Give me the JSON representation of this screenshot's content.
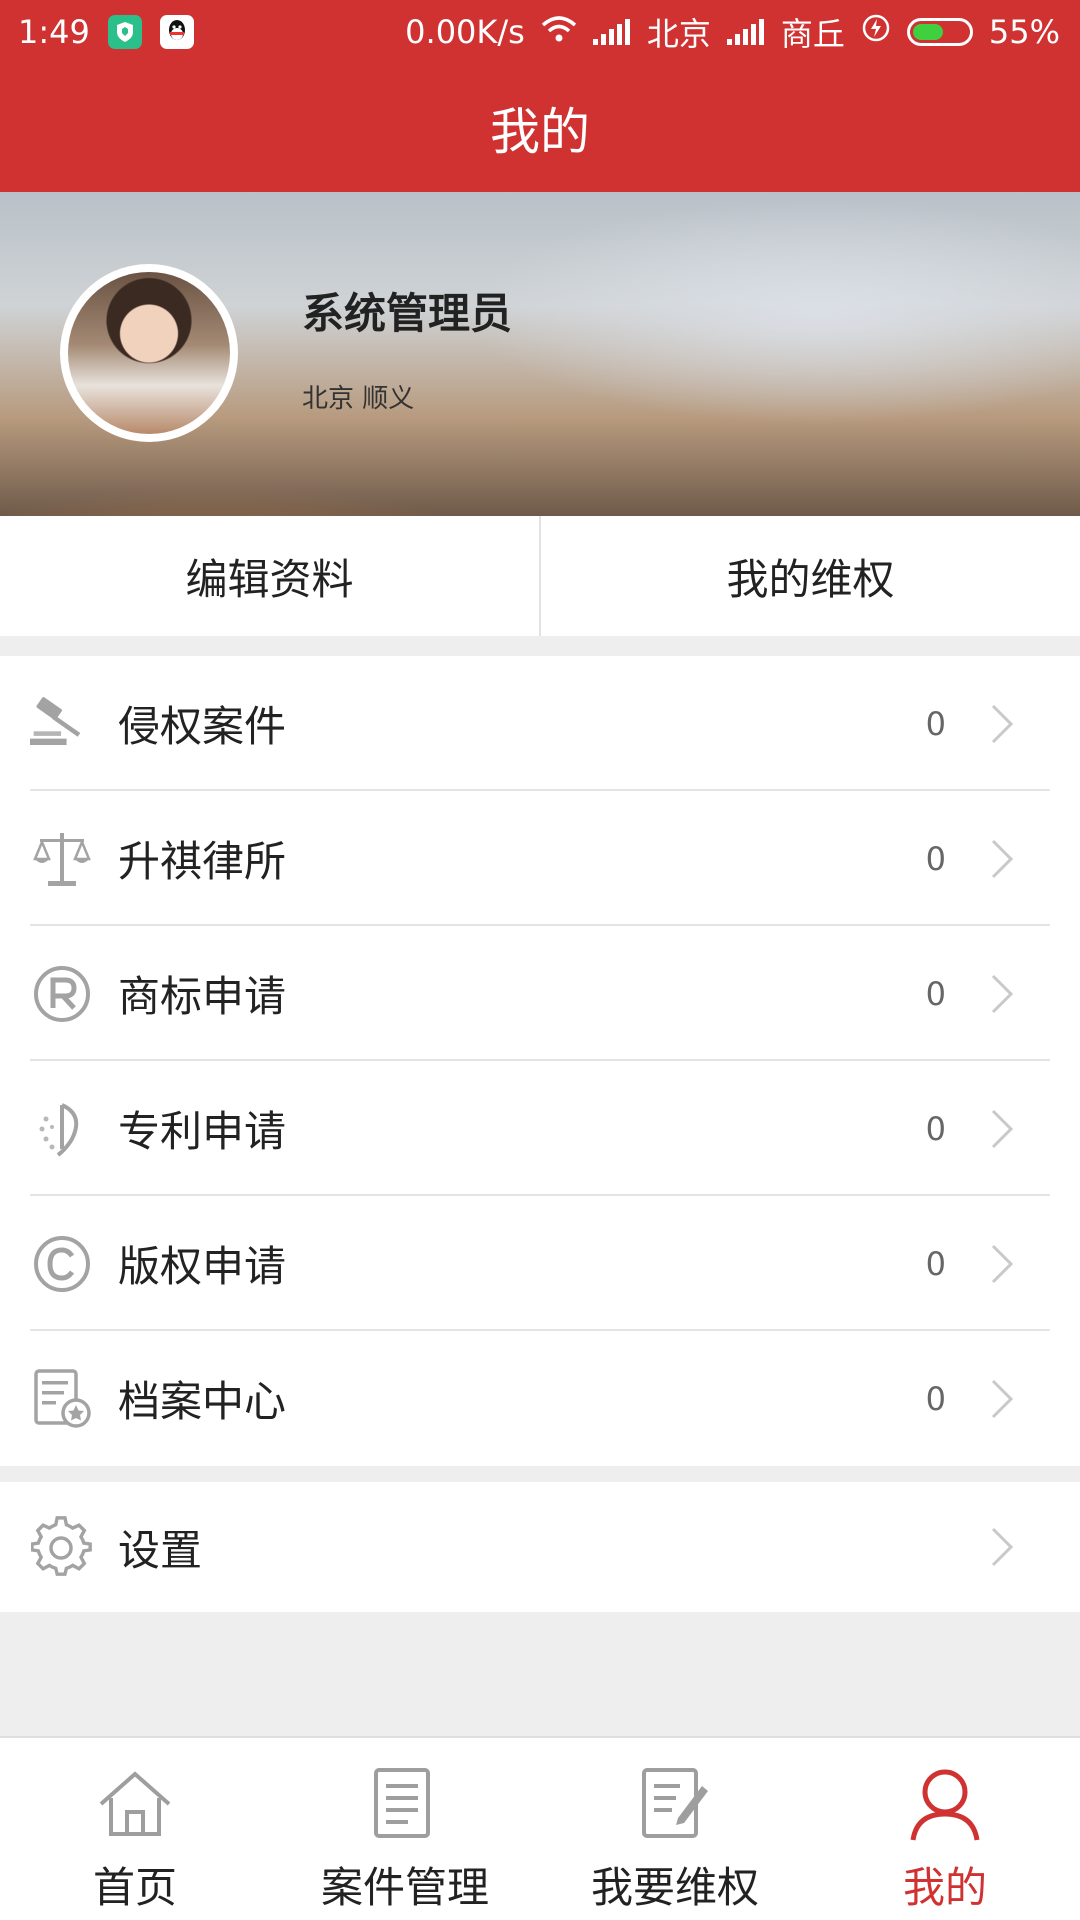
{
  "status_bar": {
    "time": "1:49",
    "net_speed": "0.00K/s",
    "carrier1": "北京",
    "carrier2": "商丘",
    "battery": "55%",
    "battery_level": 0.55
  },
  "header": {
    "title": "我的"
  },
  "profile": {
    "name": "系统管理员",
    "location": "北京 顺义"
  },
  "actions": [
    {
      "label": "编辑资料"
    },
    {
      "label": "我的维权"
    }
  ],
  "menu": [
    {
      "label": "侵权案件",
      "count": "0",
      "icon": "gavel-icon"
    },
    {
      "label": "升祺律所",
      "count": "0",
      "icon": "scales-icon"
    },
    {
      "label": "商标申请",
      "count": "0",
      "icon": "registered-icon"
    },
    {
      "label": "专利申请",
      "count": "0",
      "icon": "patent-icon"
    },
    {
      "label": "版权申请",
      "count": "0",
      "icon": "copyright-icon"
    },
    {
      "label": "档案中心",
      "count": "0",
      "icon": "archive-icon"
    }
  ],
  "settings": {
    "label": "设置",
    "icon": "gear-icon"
  },
  "bottom_nav": [
    {
      "label": "首页",
      "icon": "home-icon",
      "active": false
    },
    {
      "label": "案件管理",
      "icon": "document-icon",
      "active": false
    },
    {
      "label": "我要维权",
      "icon": "edit-document-icon",
      "active": false
    },
    {
      "label": "我的",
      "icon": "user-icon",
      "active": true
    }
  ],
  "colors": {
    "brand": "#d03232",
    "icon_gray": "#9e9e9e",
    "active_tab": "#d03232"
  }
}
